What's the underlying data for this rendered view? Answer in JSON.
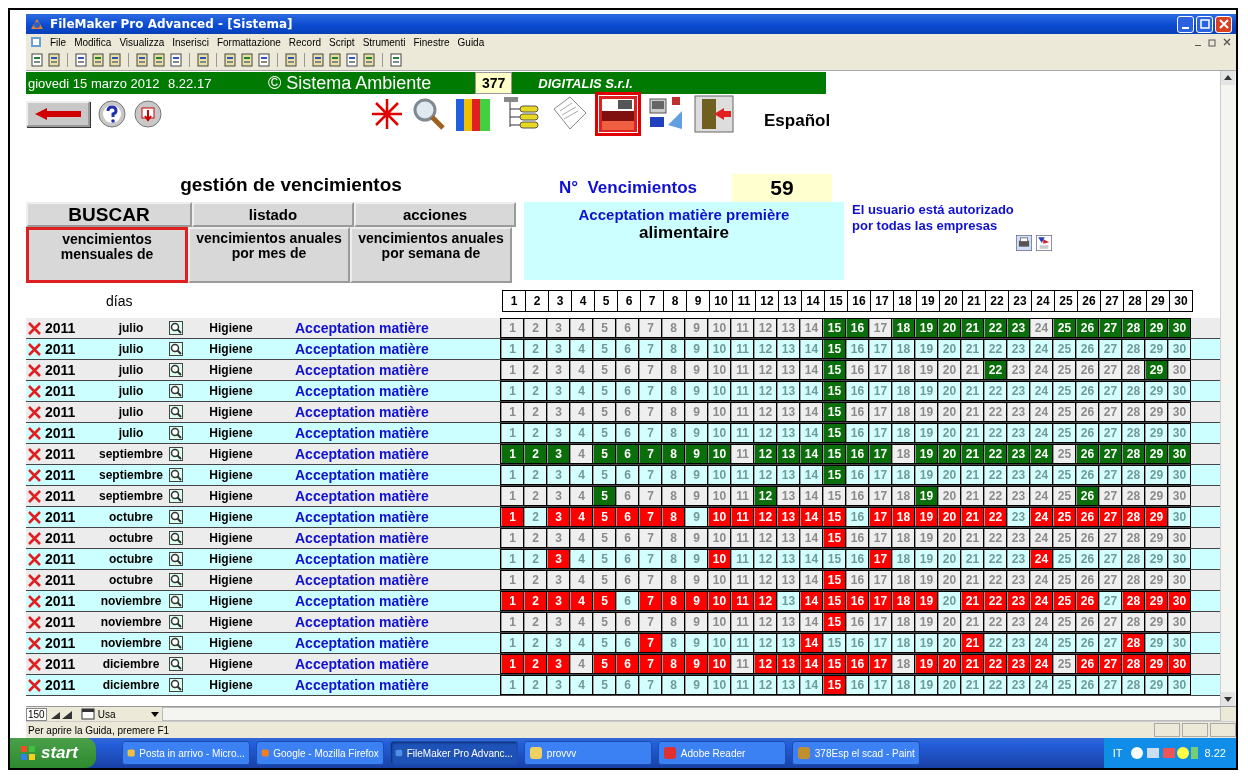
{
  "window": {
    "title": "FileMaker Pro Advanced - [Sistema]"
  },
  "menu": [
    "File",
    "Modifica",
    "Visualizza",
    "Inserisci",
    "Formattazione",
    "Record",
    "Script",
    "Strumenti",
    "Finestre",
    "Guida"
  ],
  "header": {
    "date": "giovedi 15 marzo 2012",
    "time": "8.22.17",
    "copyright": "© Sistema Ambiente",
    "count": "377",
    "company": "DIGITALIS S.r.l."
  },
  "language": "Español",
  "title": "gestión de vencimientos",
  "tabs": [
    {
      "label": "BUSCAR",
      "kind": "main"
    },
    {
      "label": "listado",
      "kind": "plain"
    },
    {
      "label": "acciones",
      "kind": "plain"
    }
  ],
  "views": [
    {
      "label": "vencimientos mensuales de",
      "selected": true
    },
    {
      "label": "vencimientos anuales por mes de",
      "selected": false
    },
    {
      "label": "vencimientos anuales por semana de",
      "selected": false
    }
  ],
  "counter": {
    "label": "N°  Vencimientos",
    "value": "59"
  },
  "topic": {
    "line1": "Acceptation matière première",
    "line2": "alimentaire"
  },
  "auth_note": "El usuario está autorizado por todas las empresas",
  "grid": {
    "label": "días",
    "days": [
      "1",
      "2",
      "3",
      "4",
      "5",
      "6",
      "7",
      "8",
      "9",
      "10",
      "11",
      "12",
      "13",
      "14",
      "15",
      "16",
      "17",
      "18",
      "19",
      "20",
      "21",
      "22",
      "23",
      "24",
      "25",
      "26",
      "27",
      "28",
      "29",
      "30"
    ],
    "rows": [
      {
        "year": "2011",
        "month": "julio",
        "area": "Higiene",
        "activity": "Acceptation matière",
        "color": "#0a6e0a",
        "days": [
          "1",
          "2",
          "3",
          "4",
          "5",
          "6",
          "7",
          "8",
          "9",
          "10",
          "11",
          "12",
          "13",
          "14",
          "15",
          "16",
          "17",
          "18",
          "19",
          "20",
          "21",
          "22",
          "23",
          "24",
          "25",
          "26",
          "27",
          "28",
          "29",
          "30"
        ],
        "marked": [
          false,
          false,
          false,
          false,
          false,
          false,
          false,
          false,
          false,
          false,
          false,
          false,
          false,
          false,
          true,
          true,
          false,
          true,
          true,
          true,
          true,
          true,
          true,
          false,
          true,
          true,
          true,
          true,
          true,
          true
        ]
      },
      {
        "year": "2011",
        "month": "julio",
        "area": "Higiene",
        "activity": "Acceptation matière",
        "color": "#0a6e0a",
        "days": [
          "1",
          "2",
          "3",
          "4",
          "5",
          "6",
          "7",
          "8",
          "9",
          "10",
          "11",
          "12",
          "13",
          "14",
          "15",
          "16",
          "17",
          "18",
          "19",
          "20",
          "21",
          "22",
          "23",
          "24",
          "25",
          "26",
          "27",
          "28",
          "29",
          "30"
        ],
        "marked": [
          false,
          false,
          false,
          false,
          false,
          false,
          false,
          false,
          false,
          false,
          false,
          false,
          false,
          false,
          true,
          false,
          false,
          false,
          false,
          false,
          false,
          false,
          false,
          false,
          false,
          false,
          false,
          false,
          false,
          false
        ]
      },
      {
        "year": "2011",
        "month": "julio",
        "area": "Higiene",
        "activity": "Acceptation matière",
        "color": "#0a6e0a",
        "days": [
          "1",
          "2",
          "3",
          "4",
          "5",
          "6",
          "7",
          "8",
          "9",
          "10",
          "11",
          "12",
          "13",
          "14",
          "15",
          "16",
          "17",
          "18",
          "19",
          "20",
          "21",
          "22",
          "23",
          "24",
          "25",
          "26",
          "27",
          "28",
          "29",
          "30"
        ],
        "marked": [
          false,
          false,
          false,
          false,
          false,
          false,
          false,
          false,
          false,
          false,
          false,
          false,
          false,
          false,
          true,
          false,
          false,
          false,
          false,
          false,
          false,
          true,
          false,
          false,
          false,
          false,
          false,
          false,
          true,
          false
        ]
      },
      {
        "year": "2011",
        "month": "julio",
        "area": "Higiene",
        "activity": "Acceptation matière",
        "color": "#0a6e0a",
        "days": [
          "1",
          "2",
          "3",
          "4",
          "5",
          "6",
          "7",
          "8",
          "9",
          "10",
          "11",
          "12",
          "13",
          "14",
          "15",
          "16",
          "17",
          "18",
          "19",
          "20",
          "21",
          "22",
          "23",
          "24",
          "25",
          "26",
          "27",
          "28",
          "29",
          "30"
        ],
        "marked": [
          false,
          false,
          false,
          false,
          false,
          false,
          false,
          false,
          false,
          false,
          false,
          false,
          false,
          false,
          true,
          false,
          false,
          false,
          false,
          false,
          false,
          false,
          false,
          false,
          false,
          false,
          false,
          false,
          false,
          false
        ]
      },
      {
        "year": "2011",
        "month": "julio",
        "area": "Higiene",
        "activity": "Acceptation matière",
        "color": "#0a6e0a",
        "days": [
          "1",
          "2",
          "3",
          "4",
          "5",
          "6",
          "7",
          "8",
          "9",
          "10",
          "11",
          "12",
          "13",
          "14",
          "15",
          "16",
          "17",
          "18",
          "19",
          "20",
          "21",
          "22",
          "23",
          "24",
          "25",
          "26",
          "27",
          "28",
          "29",
          "30"
        ],
        "marked": [
          false,
          false,
          false,
          false,
          false,
          false,
          false,
          false,
          false,
          false,
          false,
          false,
          false,
          false,
          true,
          false,
          false,
          false,
          false,
          false,
          false,
          false,
          false,
          false,
          false,
          false,
          false,
          false,
          false,
          false
        ]
      },
      {
        "year": "2011",
        "month": "julio",
        "area": "Higiene",
        "activity": "Acceptation matière",
        "color": "#0a6e0a",
        "days": [
          "1",
          "2",
          "3",
          "4",
          "5",
          "6",
          "7",
          "8",
          "9",
          "10",
          "11",
          "12",
          "13",
          "14",
          "15",
          "16",
          "17",
          "18",
          "19",
          "20",
          "21",
          "22",
          "23",
          "24",
          "25",
          "26",
          "27",
          "28",
          "29",
          "30"
        ],
        "marked": [
          false,
          false,
          false,
          false,
          false,
          false,
          false,
          false,
          false,
          false,
          false,
          false,
          false,
          false,
          true,
          false,
          false,
          false,
          false,
          false,
          false,
          false,
          false,
          false,
          false,
          false,
          false,
          false,
          false,
          false
        ]
      },
      {
        "year": "2011",
        "month": "septiembre",
        "area": "Higiene",
        "activity": "Acceptation matière",
        "color": "#0a6e0a",
        "days": [
          "1",
          "2",
          "3",
          "4",
          "5",
          "6",
          "7",
          "8",
          "9",
          "10",
          "11",
          "12",
          "13",
          "14",
          "15",
          "16",
          "17",
          "18",
          "19",
          "20",
          "21",
          "22",
          "23",
          "24",
          "25",
          "26",
          "27",
          "28",
          "29",
          "30"
        ],
        "marked": [
          true,
          true,
          true,
          false,
          true,
          true,
          true,
          true,
          true,
          true,
          false,
          true,
          true,
          true,
          true,
          true,
          true,
          false,
          true,
          true,
          true,
          true,
          true,
          true,
          false,
          true,
          true,
          true,
          true,
          true
        ]
      },
      {
        "year": "2011",
        "month": "septiembre",
        "area": "Higiene",
        "activity": "Acceptation matière",
        "color": "#0a6e0a",
        "days": [
          "1",
          "2",
          "3",
          "4",
          "5",
          "6",
          "7",
          "8",
          "9",
          "10",
          "11",
          "12",
          "13",
          "14",
          "15",
          "16",
          "17",
          "18",
          "19",
          "20",
          "21",
          "22",
          "23",
          "24",
          "25",
          "26",
          "27",
          "28",
          "29",
          "30"
        ],
        "marked": [
          false,
          false,
          false,
          false,
          false,
          false,
          false,
          false,
          false,
          false,
          false,
          false,
          false,
          false,
          true,
          false,
          false,
          false,
          false,
          false,
          false,
          false,
          false,
          false,
          false,
          false,
          false,
          false,
          false,
          false
        ]
      },
      {
        "year": "2011",
        "month": "septiembre",
        "area": "Higiene",
        "activity": "Acceptation matière",
        "color": "#0a6e0a",
        "days": [
          "1",
          "2",
          "3",
          "4",
          "5",
          "6",
          "7",
          "8",
          "9",
          "10",
          "11",
          "12",
          "13",
          "14",
          "15",
          "16",
          "17",
          "18",
          "19",
          "20",
          "21",
          "22",
          "23",
          "24",
          "25",
          "26",
          "27",
          "28",
          "29",
          "30"
        ],
        "marked": [
          false,
          false,
          false,
          false,
          true,
          false,
          false,
          false,
          false,
          false,
          false,
          true,
          false,
          false,
          false,
          false,
          false,
          false,
          true,
          false,
          false,
          false,
          false,
          false,
          false,
          true,
          false,
          false,
          false,
          false
        ]
      },
      {
        "year": "2011",
        "month": "octubre",
        "area": "Higiene",
        "activity": "Acceptation matière",
        "color": "#ff0000",
        "days": [
          "1",
          "2",
          "3",
          "4",
          "5",
          "6",
          "7",
          "8",
          "9",
          "10",
          "11",
          "12",
          "13",
          "14",
          "15",
          "16",
          "17",
          "18",
          "19",
          "20",
          "21",
          "22",
          "23",
          "24",
          "25",
          "26",
          "27",
          "28",
          "29",
          "30"
        ],
        "marked": [
          true,
          false,
          true,
          true,
          true,
          true,
          true,
          true,
          false,
          true,
          true,
          true,
          true,
          true,
          true,
          false,
          true,
          true,
          true,
          true,
          true,
          true,
          false,
          true,
          true,
          true,
          true,
          true,
          true,
          false
        ]
      },
      {
        "year": "2011",
        "month": "octubre",
        "area": "Higiene",
        "activity": "Acceptation matière",
        "color": "#ff0000",
        "days": [
          "1",
          "2",
          "3",
          "4",
          "5",
          "6",
          "7",
          "8",
          "9",
          "10",
          "11",
          "12",
          "13",
          "14",
          "15",
          "16",
          "17",
          "18",
          "19",
          "20",
          "21",
          "22",
          "23",
          "24",
          "25",
          "26",
          "27",
          "28",
          "29",
          "30"
        ],
        "marked": [
          false,
          false,
          false,
          false,
          false,
          false,
          false,
          false,
          false,
          false,
          false,
          false,
          false,
          false,
          true,
          false,
          false,
          false,
          false,
          false,
          false,
          false,
          false,
          false,
          false,
          false,
          false,
          false,
          false,
          false
        ]
      },
      {
        "year": "2011",
        "month": "octubre",
        "area": "Higiene",
        "activity": "Acceptation matière",
        "color": "#ff0000",
        "days": [
          "1",
          "2",
          "3",
          "4",
          "5",
          "6",
          "7",
          "8",
          "9",
          "10",
          "11",
          "12",
          "13",
          "14",
          "15",
          "16",
          "17",
          "18",
          "19",
          "20",
          "21",
          "22",
          "23",
          "24",
          "25",
          "26",
          "27",
          "28",
          "29",
          "30"
        ],
        "marked": [
          false,
          false,
          true,
          false,
          false,
          false,
          false,
          false,
          false,
          true,
          false,
          false,
          false,
          false,
          false,
          false,
          true,
          false,
          false,
          false,
          false,
          false,
          false,
          true,
          false,
          false,
          false,
          false,
          false,
          false
        ]
      },
      {
        "year": "2011",
        "month": "octubre",
        "area": "Higiene",
        "activity": "Acceptation matière",
        "color": "#ff0000",
        "days": [
          "1",
          "2",
          "3",
          "4",
          "5",
          "6",
          "7",
          "8",
          "9",
          "10",
          "11",
          "12",
          "13",
          "14",
          "15",
          "16",
          "17",
          "18",
          "19",
          "20",
          "21",
          "22",
          "23",
          "24",
          "25",
          "26",
          "27",
          "28",
          "29",
          "30"
        ],
        "marked": [
          false,
          false,
          false,
          false,
          false,
          false,
          false,
          false,
          false,
          false,
          false,
          false,
          false,
          false,
          true,
          false,
          false,
          false,
          false,
          false,
          false,
          false,
          false,
          false,
          false,
          false,
          false,
          false,
          false,
          false
        ]
      },
      {
        "year": "2011",
        "month": "noviembre",
        "area": "Higiene",
        "activity": "Acceptation matière",
        "color": "#ff0000",
        "days": [
          "1",
          "2",
          "3",
          "4",
          "5",
          "6",
          "7",
          "8",
          "9",
          "10",
          "11",
          "12",
          "13",
          "14",
          "15",
          "16",
          "17",
          "18",
          "19",
          "20",
          "21",
          "22",
          "23",
          "24",
          "25",
          "26",
          "27",
          "28",
          "29",
          "30"
        ],
        "marked": [
          true,
          true,
          true,
          true,
          true,
          false,
          true,
          true,
          true,
          true,
          true,
          true,
          false,
          true,
          true,
          true,
          true,
          true,
          true,
          false,
          true,
          true,
          true,
          true,
          true,
          true,
          false,
          true,
          true,
          true
        ]
      },
      {
        "year": "2011",
        "month": "noviembre",
        "area": "Higiene",
        "activity": "Acceptation matière",
        "color": "#ff0000",
        "days": [
          "1",
          "2",
          "3",
          "4",
          "5",
          "6",
          "7",
          "8",
          "9",
          "10",
          "11",
          "12",
          "13",
          "14",
          "15",
          "16",
          "17",
          "18",
          "19",
          "20",
          "21",
          "22",
          "23",
          "24",
          "25",
          "26",
          "27",
          "28",
          "29",
          "30"
        ],
        "marked": [
          false,
          false,
          false,
          false,
          false,
          false,
          false,
          false,
          false,
          false,
          false,
          false,
          false,
          false,
          true,
          false,
          false,
          false,
          false,
          false,
          false,
          false,
          false,
          false,
          false,
          false,
          false,
          false,
          false,
          false
        ]
      },
      {
        "year": "2011",
        "month": "noviembre",
        "area": "Higiene",
        "activity": "Acceptation matière",
        "color": "#ff0000",
        "days": [
          "1",
          "2",
          "3",
          "4",
          "5",
          "6",
          "7",
          "8",
          "9",
          "10",
          "11",
          "12",
          "13",
          "14",
          "15",
          "16",
          "17",
          "18",
          "19",
          "20",
          "21",
          "22",
          "23",
          "24",
          "25",
          "26",
          "27",
          "28",
          "29",
          "30"
        ],
        "marked": [
          false,
          false,
          false,
          false,
          false,
          false,
          true,
          false,
          false,
          false,
          false,
          false,
          false,
          true,
          false,
          false,
          false,
          false,
          false,
          false,
          true,
          false,
          false,
          false,
          false,
          false,
          false,
          true,
          false,
          false
        ]
      },
      {
        "year": "2011",
        "month": "diciembre",
        "area": "Higiene",
        "activity": "Acceptation matière",
        "color": "#ff0000",
        "days": [
          "1",
          "2",
          "3",
          "4",
          "5",
          "6",
          "7",
          "8",
          "9",
          "10",
          "11",
          "12",
          "13",
          "14",
          "15",
          "16",
          "17",
          "18",
          "19",
          "20",
          "21",
          "22",
          "23",
          "24",
          "25",
          "26",
          "27",
          "28",
          "29",
          "30"
        ],
        "marked": [
          true,
          true,
          true,
          false,
          true,
          true,
          true,
          true,
          true,
          true,
          false,
          true,
          true,
          true,
          true,
          true,
          true,
          false,
          true,
          true,
          true,
          true,
          true,
          true,
          false,
          true,
          true,
          true,
          true,
          true
        ]
      },
      {
        "year": "2011",
        "month": "diciembre",
        "area": "Higiene",
        "activity": "Acceptation matière",
        "color": "#ff0000",
        "days": [
          "1",
          "2",
          "3",
          "4",
          "5",
          "6",
          "7",
          "8",
          "9",
          "10",
          "11",
          "12",
          "13",
          "14",
          "15",
          "16",
          "17",
          "18",
          "19",
          "20",
          "21",
          "22",
          "23",
          "24",
          "25",
          "26",
          "27",
          "28",
          "29",
          "30"
        ],
        "marked": [
          false,
          false,
          false,
          false,
          false,
          false,
          false,
          false,
          false,
          false,
          false,
          false,
          false,
          false,
          true,
          false,
          false,
          false,
          false,
          false,
          false,
          false,
          false,
          false,
          false,
          false,
          false,
          false,
          false,
          false
        ]
      }
    ]
  },
  "status_bar": {
    "zoom": "150",
    "mode": "Usa",
    "hint": "Per aprire la Guida, premere F1"
  },
  "taskbar": {
    "start": "start",
    "items": [
      {
        "label": "Posta in arrivo - Micro...",
        "selected": false
      },
      {
        "label": "Google - Mozilla Firefox",
        "selected": false
      },
      {
        "label": "FileMaker Pro Advanc...",
        "selected": true
      },
      {
        "label": "provvv",
        "selected": false
      },
      {
        "label": "Adobe Reader",
        "selected": false
      },
      {
        "label": "378Esp el scad - Paint",
        "selected": false
      }
    ],
    "lang": "IT",
    "clock": "8.22"
  }
}
